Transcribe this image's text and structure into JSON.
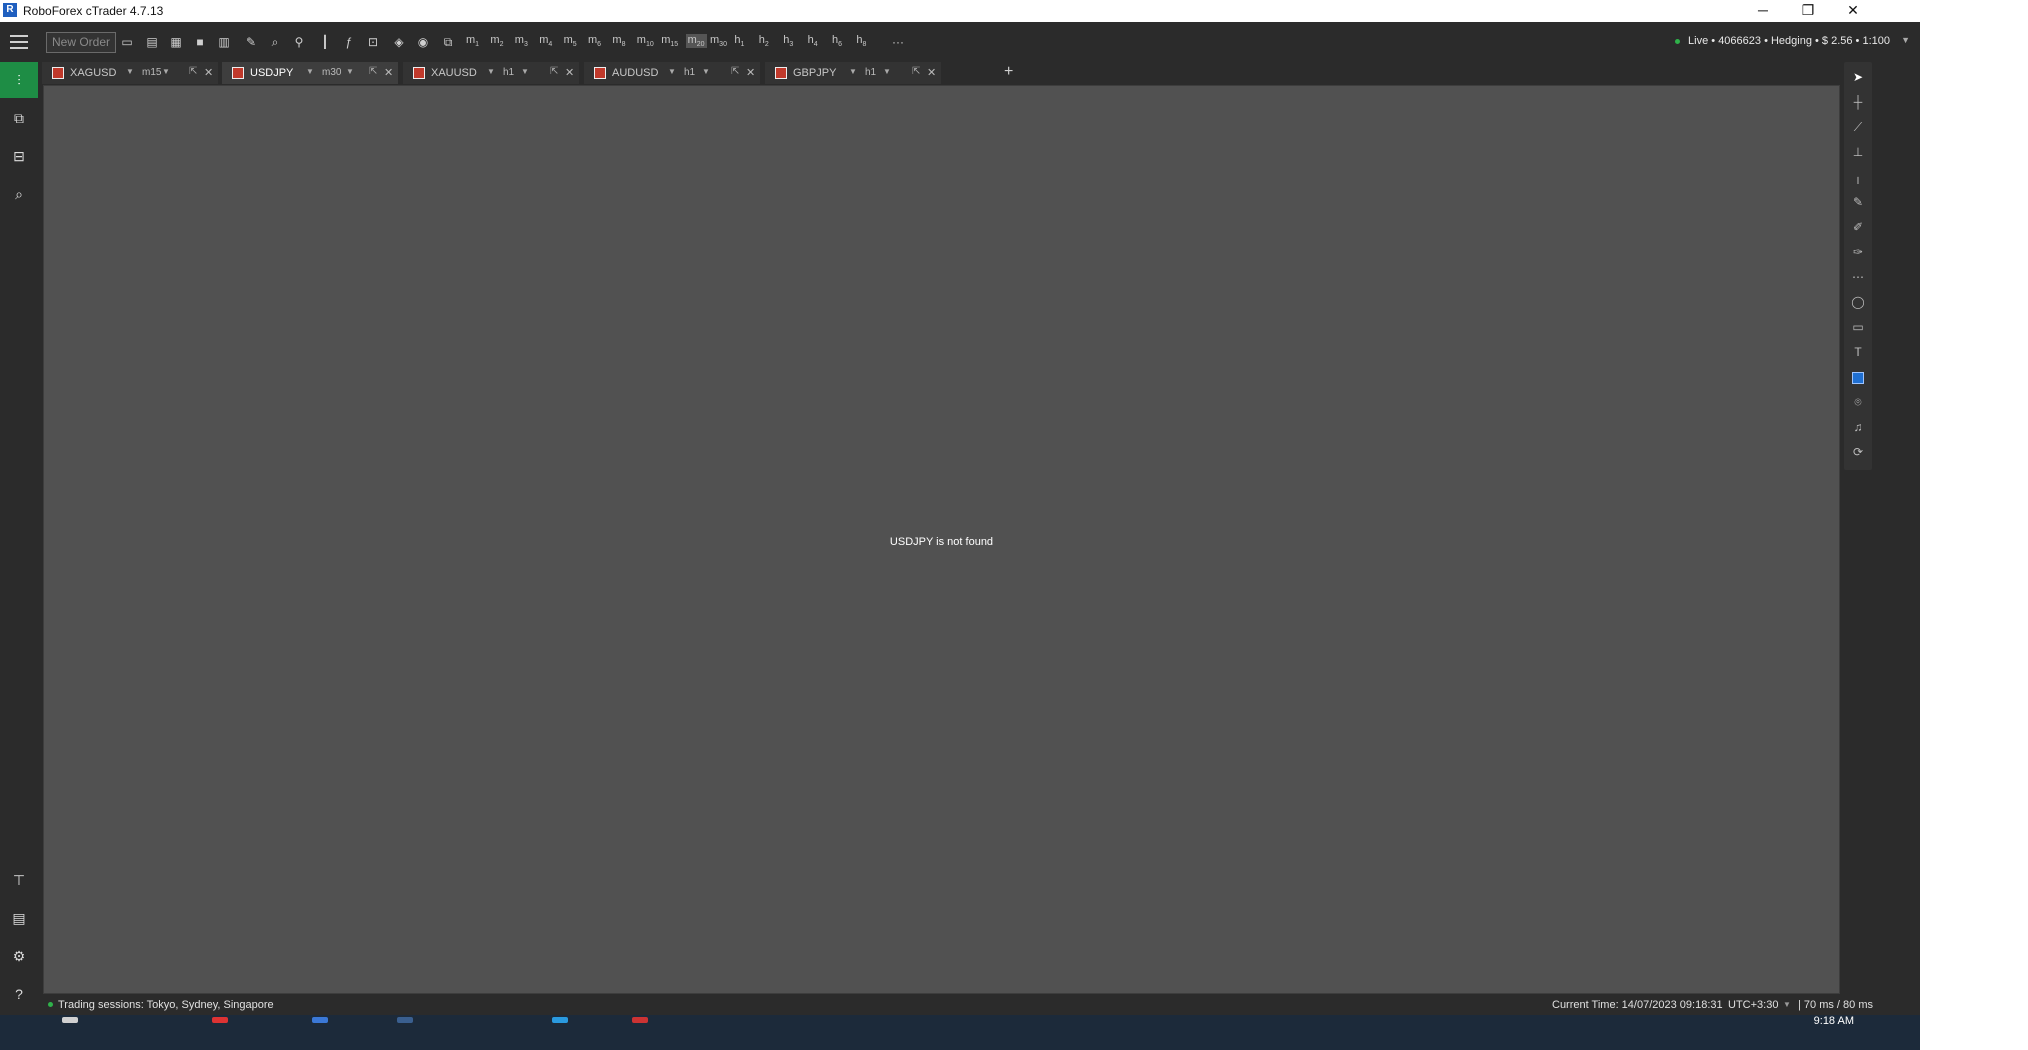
{
  "window": {
    "title": "RoboForex cTrader 4.7.13",
    "logo_letter": "R",
    "minimize": "─",
    "restore": "❐",
    "close": "✕"
  },
  "toolbar": {
    "new_order_label": "New Order",
    "timeframes": [
      {
        "base": "m",
        "sub": "1"
      },
      {
        "base": "m",
        "sub": "2"
      },
      {
        "base": "m",
        "sub": "3"
      },
      {
        "base": "m",
        "sub": "4"
      },
      {
        "base": "m",
        "sub": "5"
      },
      {
        "base": "m",
        "sub": "6"
      },
      {
        "base": "m",
        "sub": "8"
      },
      {
        "base": "m",
        "sub": "10"
      },
      {
        "base": "m",
        "sub": "15"
      },
      {
        "base": "m",
        "sub": "20"
      },
      {
        "base": "m",
        "sub": "30"
      },
      {
        "base": "h",
        "sub": "1"
      },
      {
        "base": "h",
        "sub": "2"
      },
      {
        "base": "h",
        "sub": "3"
      },
      {
        "base": "h",
        "sub": "4"
      },
      {
        "base": "h",
        "sub": "6"
      },
      {
        "base": "h",
        "sub": "8"
      }
    ],
    "active_timeframe_index": 9,
    "more_label": "···",
    "account_label": "Live • 4066623 • Hedging • $ 2.56 • 1:100",
    "account_caret": "▼"
  },
  "tabs": [
    {
      "symbol": "XAGUSD",
      "tf": "m15",
      "active": false
    },
    {
      "symbol": "USDJPY",
      "tf": "m30",
      "active": true
    },
    {
      "symbol": "XAUUSD",
      "tf": "h1",
      "active": false
    },
    {
      "symbol": "AUDUSD",
      "tf": "h1",
      "active": false
    },
    {
      "symbol": "GBPJPY",
      "tf": "h1",
      "active": false
    }
  ],
  "tab_add_label": "+",
  "chart": {
    "message": "USDJPY is not found"
  },
  "status": {
    "sessions": "Trading sessions: Tokyo, Sydney, Singapore",
    "current_time": "Current Time:  14/07/2023 09:18:31",
    "timezone": "UTC+3:30",
    "latency": "| 70 ms / 80 ms"
  },
  "taskbar": {
    "clock": "9:18 AM"
  },
  "colors": {
    "accent_green": "#1e8d45",
    "chart_bg": "#515151",
    "app_bg": "#2b2b2b"
  },
  "icons": {
    "sidebar_top": [
      "trade-icon",
      "copy-icon",
      "automate-icon",
      "analyze-icon"
    ],
    "sidebar_bottom": [
      "trading-panel-icon",
      "news-icon",
      "settings-icon",
      "help-icon"
    ],
    "drawing_tools": [
      "cursor-icon",
      "crosshair-icon",
      "line-icon",
      "fibonacci-icon",
      "vertical-line-icon",
      "pen-icon",
      "brush-icon",
      "marker-icon",
      "grid-icon",
      "ellipse-icon",
      "rectangle-icon",
      "text-icon",
      "color-icon",
      "camera-icon",
      "alert-icon",
      "replay-icon"
    ]
  }
}
